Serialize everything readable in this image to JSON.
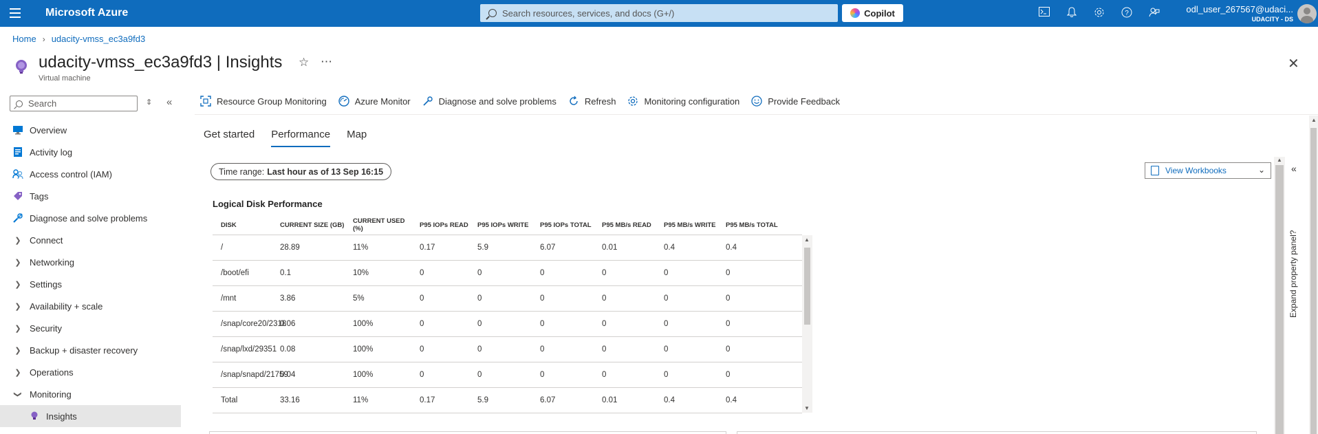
{
  "topbar": {
    "brand": "Microsoft Azure",
    "search_placeholder": "Search resources, services, and docs (G+/)",
    "copilot_label": "Copilot",
    "user_name": "odl_user_267567@udaci...",
    "user_directory": "UDACITY - DS",
    "icons": [
      "cloud-shell-icon",
      "bell-icon",
      "gear-icon",
      "help-icon",
      "feedback-icon"
    ]
  },
  "breadcrumb": {
    "home": "Home",
    "resource": "udacity-vmss_ec3a9fd3"
  },
  "page": {
    "title": "udacity-vmss_ec3a9fd3 | Insights",
    "subtitle": "Virtual machine"
  },
  "sidebar": {
    "search_placeholder": "Search",
    "items": [
      {
        "label": "Overview",
        "icon": "monitor-icon",
        "expandable": false
      },
      {
        "label": "Activity log",
        "icon": "log-icon",
        "expandable": false
      },
      {
        "label": "Access control (IAM)",
        "icon": "people-icon",
        "expandable": false
      },
      {
        "label": "Tags",
        "icon": "tag-icon",
        "expandable": false
      },
      {
        "label": "Diagnose and solve problems",
        "icon": "wrench-icon",
        "expandable": false
      },
      {
        "label": "Connect",
        "expandable": true
      },
      {
        "label": "Networking",
        "expandable": true
      },
      {
        "label": "Settings",
        "expandable": true
      },
      {
        "label": "Availability + scale",
        "expandable": true
      },
      {
        "label": "Security",
        "expandable": true
      },
      {
        "label": "Backup + disaster recovery",
        "expandable": true
      },
      {
        "label": "Operations",
        "expandable": true
      },
      {
        "label": "Monitoring",
        "expandable": true,
        "expanded": true
      },
      {
        "label": "Insights",
        "icon": "bulb-icon",
        "selected": true
      }
    ]
  },
  "toolbar": {
    "resource_group_monitoring": "Resource Group Monitoring",
    "azure_monitor": "Azure Monitor",
    "diagnose": "Diagnose and solve problems",
    "refresh": "Refresh",
    "monitoring_config": "Monitoring configuration",
    "feedback": "Provide Feedback"
  },
  "tabs": [
    {
      "label": "Get started",
      "active": false
    },
    {
      "label": "Performance",
      "active": true
    },
    {
      "label": "Map",
      "active": false
    }
  ],
  "time_range": {
    "label": "Time range:",
    "value": "Last hour as of 13 Sep 16:15"
  },
  "view_workbooks": "View Workbooks",
  "expand_panel": "Expand property panel?",
  "table": {
    "title": "Logical Disk Performance",
    "headers": [
      "DISK",
      "CURRENT SIZE (GB)",
      "CURRENT USED (%)",
      "P95 IOPs READ",
      "P95 IOPs WRITE",
      "P95 IOPs TOTAL",
      "P95 MB/s READ",
      "P95 MB/s WRITE",
      "P95 MB/s TOTAL"
    ],
    "rows": [
      [
        "/",
        "28.89",
        "11%",
        "0.17",
        "5.9",
        "6.07",
        "0.01",
        "0.4",
        "0.4"
      ],
      [
        "/boot/efi",
        "0.1",
        "10%",
        "0",
        "0",
        "0",
        "0",
        "0",
        "0"
      ],
      [
        "/mnt",
        "3.86",
        "5%",
        "0",
        "0",
        "0",
        "0",
        "0",
        "0"
      ],
      [
        "/snap/core20/2318",
        "0.06",
        "100%",
        "0",
        "0",
        "0",
        "0",
        "0",
        "0"
      ],
      [
        "/snap/lxd/29351",
        "0.08",
        "100%",
        "0",
        "0",
        "0",
        "0",
        "0",
        "0"
      ],
      [
        "/snap/snapd/21759",
        "0.04",
        "100%",
        "0",
        "0",
        "0",
        "0",
        "0",
        "0"
      ],
      [
        "Total",
        "33.16",
        "11%",
        "0.17",
        "5.9",
        "6.07",
        "0.01",
        "0.4",
        "0.4"
      ]
    ]
  }
}
